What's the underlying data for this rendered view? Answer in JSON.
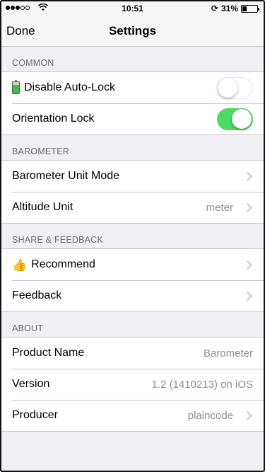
{
  "status": {
    "time": "10:51",
    "battery": "31%",
    "battery_level": 0.31
  },
  "nav": {
    "done": "Done",
    "title": "Settings"
  },
  "sections": {
    "common": {
      "header": "COMMON",
      "rows": [
        {
          "label": "Disable Auto-Lock",
          "icon": "battery-emoji-icon",
          "toggle": false
        },
        {
          "label": "Orientation Lock",
          "toggle": true
        }
      ]
    },
    "barometer": {
      "header": "BAROMETER",
      "rows": [
        {
          "label": "Barometer Unit Mode",
          "value": ""
        },
        {
          "label": "Altitude Unit",
          "value": "meter"
        }
      ]
    },
    "share": {
      "header": "SHARE & FEEDBACK",
      "rows": [
        {
          "label": "Recommend",
          "icon": "thumbs-up-icon"
        },
        {
          "label": "Feedback"
        }
      ]
    },
    "about": {
      "header": "ABOUT",
      "rows": [
        {
          "label": "Product Name",
          "value": "Barometer"
        },
        {
          "label": "Version",
          "value": "1.2 (1410213) on iOS"
        },
        {
          "label": "Producer",
          "value": "plaincode"
        }
      ]
    }
  }
}
